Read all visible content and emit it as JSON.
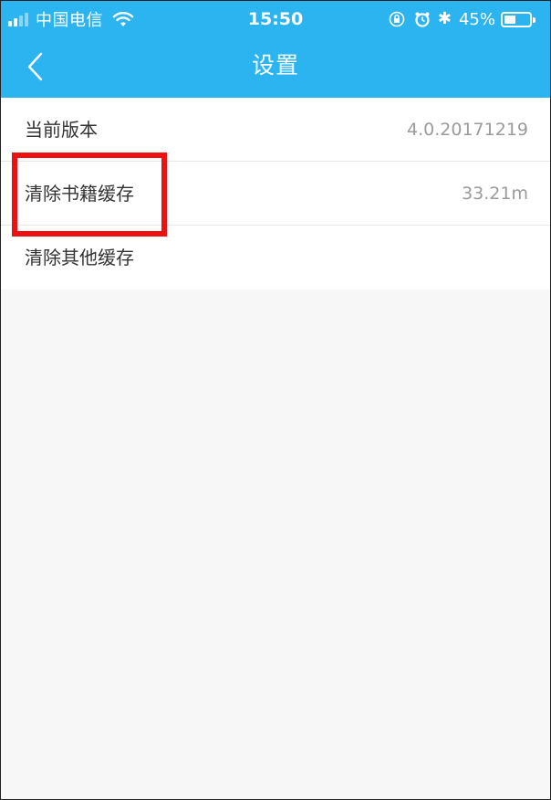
{
  "status_bar": {
    "carrier": "中国电信",
    "time": "15:50",
    "battery_percent": "45%",
    "battery_level": 0.45,
    "bluetooth_symbol": "✱",
    "icons": [
      "signal-icon",
      "wifi-icon",
      "rotation-lock-icon",
      "alarm-icon",
      "bluetooth-icon",
      "battery-icon"
    ]
  },
  "nav": {
    "title": "设置",
    "back_icon": "chevron-left-icon"
  },
  "settings": [
    {
      "label": "当前版本",
      "value": "4.0.20171219"
    },
    {
      "label": "清除书籍缓存",
      "value": "33.21m"
    },
    {
      "label": "清除其他缓存",
      "value": ""
    }
  ],
  "colors": {
    "header_bg": "#2bb4f0",
    "page_bg": "#f7f7f7",
    "highlight": "#ee1111",
    "label_text": "#333333",
    "value_text": "#9b9b9b"
  }
}
